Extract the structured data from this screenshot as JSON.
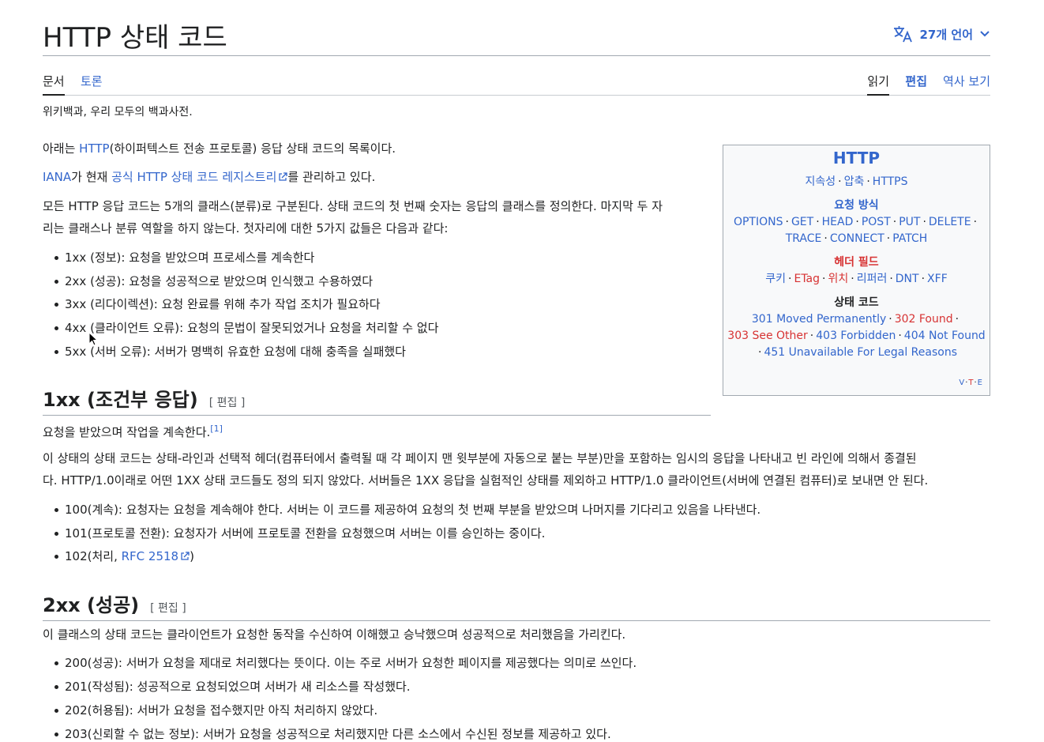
{
  "header": {
    "title": "HTTP 상태 코드",
    "languages": "27개 언어"
  },
  "tabs": {
    "article": "문서",
    "talk": "토론",
    "read": "읽기",
    "edit": "편집",
    "history": "역사 보기"
  },
  "tagline": "위키백과, 우리 모두의 백과사전.",
  "intro": {
    "p1_pre": "아래는 ",
    "p1_link": "HTTP",
    "p1_post": "(하이퍼텍스트 전송 프로토콜) 응답 상태 코드의 목록이다.",
    "p2_link1": "IANA",
    "p2_mid": "가 현재 ",
    "p2_link2": "공식 HTTP 상태 코드 레지스트리",
    "p2_post": "를 관리하고 있다.",
    "p3_line1": "모든 HTTP 응답 코드는 5개의 클래스(분류)로 구분된다. 상태 코드의 첫 번째 숫자는 응답의 클래스를 정의한다. 마지막 두 자",
    "p3_line2": "리는 클래스나 분류 역할을 하지 않는다. 첫자리에 대한 5가지 값들은 다음과 같다:",
    "classes": [
      "1xx (정보): 요청을 받았으며 프로세스를 계속한다",
      "2xx (성공): 요청을 성공적으로 받았으며 인식했고 수용하였다",
      "3xx (리다이렉션): 요청 완료를 위해 추가 작업 조치가 필요하다",
      "4xx (클라이언트 오류): 요청의 문법이 잘못되었거나 요청을 처리할 수 없다",
      "5xx (서버 오류): 서버가 명백히 유효한 요청에 대해 충족을 실패했다"
    ]
  },
  "section_1xx": {
    "heading": "1xx (조건부 응답)",
    "edit_label": "[ 편집 ]",
    "lead": "요청을 받았으며 작업을 계속한다.",
    "ref": "[1]",
    "p_line1": "이 상태의 상태 코드는 상태-라인과 선택적 헤더(컴퓨터에서 출력될 때 각 페이지 맨 윗부분에 자동으로 붙는 부분)만을 포함하는 임시의 응답을 나타내고 빈 라인에 의해서 종결된",
    "p_line2": "다. HTTP/1.0이래로 어떤 1XX 상태 코드들도 정의 되지 않았다. 서버들은 1XX 응답을 실험적인 상태를 제외하고 HTTP/1.0 클라이언트(서버에 연결된 컴퓨터)로 보내면 안 된다.",
    "items": [
      "100(계속): 요청자는 요청을 계속해야 한다. 서버는 이 코드를 제공하여 요청의 첫 번째 부분을 받았으며 나머지를 기다리고 있음을 나타낸다.",
      "101(프로토콜 전환): 요청자가 서버에 프로토콜 전환을 요청했으며 서버는 이를 승인하는 중이다."
    ],
    "item3_pre": "102(처리, ",
    "item3_link": "RFC 2518",
    "item3_post": ")"
  },
  "section_2xx": {
    "heading": "2xx (성공)",
    "edit_label": "[ 편집 ]",
    "lead": "이 클래스의 상태 코드는 클라이언트가 요청한 동작을 수신하여 이해했고 승낙했으며 성공적으로 처리했음을 가리킨다.",
    "items": [
      "200(성공): 서버가 요청을 제대로 처리했다는 뜻이다. 이는 주로 서버가 요청한 페이지를 제공했다는 의미로 쓰인다.",
      "201(작성됨): 성공적으로 요청되었으며 서버가 새 리소스를 작성했다.",
      "202(허용됨): 서버가 요청을 접수했지만 아직 처리하지 않았다.",
      "203(신뢰할 수 없는 정보): 서버가 요청을 성공적으로 처리했지만 다른 소스에서 수신된 정보를 제공하고 있다."
    ]
  },
  "infobox": {
    "title": "HTTP",
    "row1": [
      "지속성",
      "압축",
      "HTTPS"
    ],
    "methods_heading": "요청 방식",
    "methods_line1": [
      "OPTIONS",
      "GET",
      "HEAD",
      "POST",
      "PUT",
      "DELETE"
    ],
    "methods_line2": [
      "TRACE",
      "CONNECT",
      "PATCH"
    ],
    "headers_heading": "헤더 필드",
    "headers": [
      "쿠키",
      "ETag",
      "위치",
      "리퍼러",
      "DNT",
      "XFF"
    ],
    "status_heading": "상태 코드",
    "status_line1": [
      "301 Moved Permanently",
      "302 Found"
    ],
    "status_line2": [
      "303 See Other",
      "403 Forbidden",
      "404 Not Found"
    ],
    "status_line3": [
      "451 Unavailable For Legal Reasons"
    ],
    "vte": [
      "V",
      "T",
      "E"
    ]
  },
  "colors": {
    "link": "#3366cc",
    "redlink": "#d73333",
    "text": "#202122"
  }
}
